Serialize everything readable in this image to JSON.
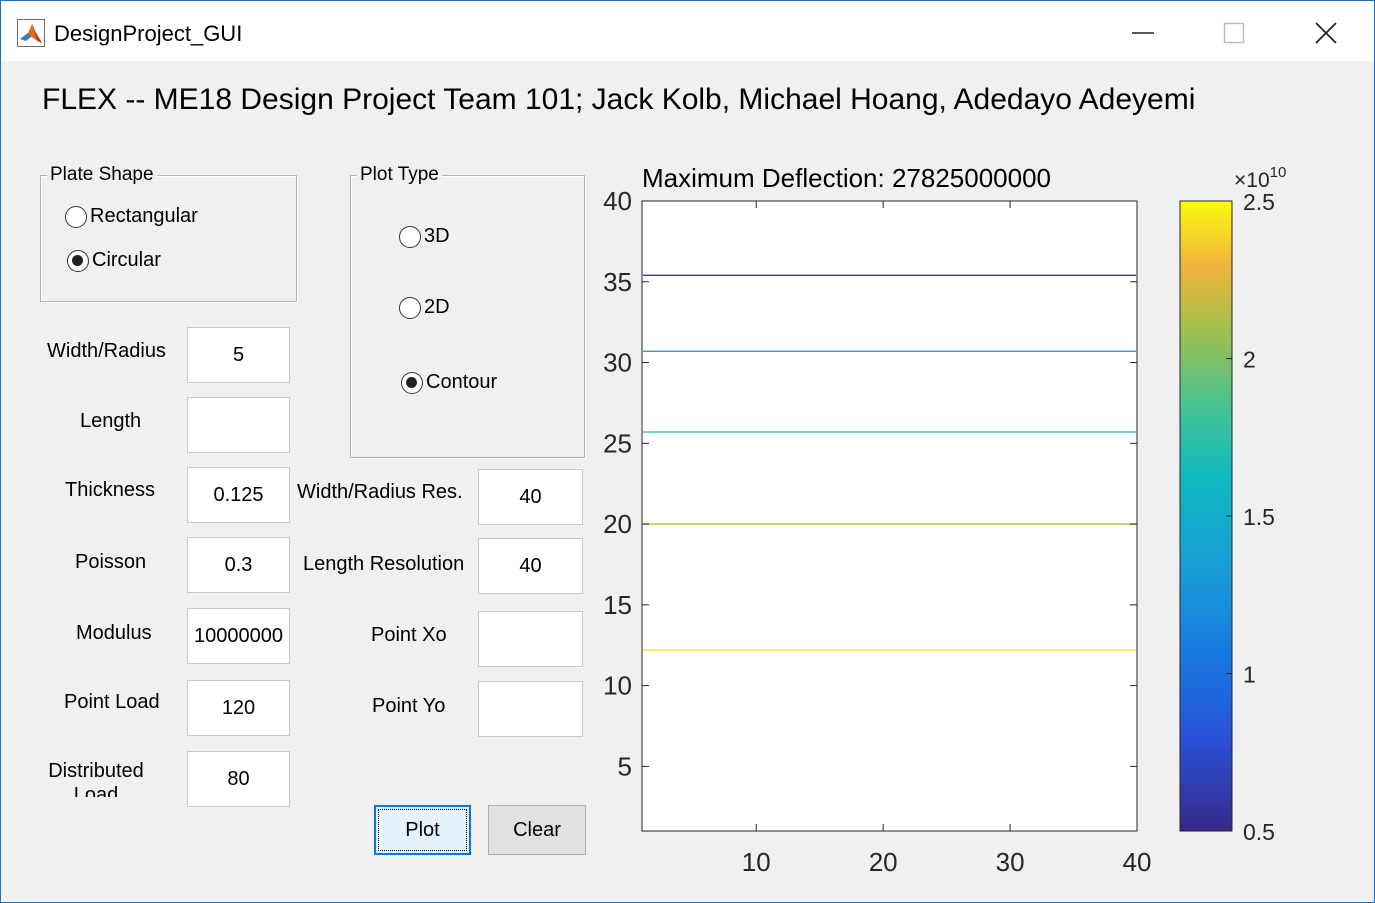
{
  "window": {
    "title": "DesignProject_GUI",
    "icon": "matlab-icon",
    "controls": [
      "minimize-icon",
      "maximize-icon",
      "close-icon"
    ]
  },
  "heading": "FLEX -- ME18 Design Project Team 101; Jack Kolb, Michael Hoang, Adedayo Adeyemi",
  "plate_shape": {
    "title": "Plate Shape",
    "options": [
      {
        "label": "Rectangular",
        "selected": false
      },
      {
        "label": "Circular",
        "selected": true
      }
    ]
  },
  "plot_type": {
    "title": "Plot Type",
    "options": [
      {
        "label": "3D",
        "selected": false
      },
      {
        "label": "2D",
        "selected": false
      },
      {
        "label": "Contour",
        "selected": true
      }
    ]
  },
  "inputs": {
    "width_radius": {
      "label": "Width/Radius",
      "value": "5"
    },
    "length": {
      "label": "Length",
      "value": ""
    },
    "thickness": {
      "label": "Thickness",
      "value": "0.125"
    },
    "poisson": {
      "label": "Poisson",
      "value": "0.3"
    },
    "modulus": {
      "label": "Modulus",
      "value": "10000000"
    },
    "point_load": {
      "label": "Point Load",
      "value": "120"
    },
    "distributed_load": {
      "label": "Distributed Load",
      "value": "80"
    },
    "width_radius_res": {
      "label": "Width/Radius Res.",
      "value": "40"
    },
    "length_resolution": {
      "label": "Length Resolution",
      "value": "40"
    },
    "point_xo": {
      "label": "Point Xo",
      "value": ""
    },
    "point_yo": {
      "label": "Point Yo",
      "value": ""
    }
  },
  "buttons": {
    "plot": "Plot",
    "clear": "Clear"
  },
  "chart_data": {
    "type": "contour",
    "title": "Maximum Deflection: 27825000000",
    "xlim": [
      1,
      40
    ],
    "ylim": [
      1,
      40
    ],
    "xticks": [
      10,
      20,
      30,
      40
    ],
    "yticks": [
      5,
      10,
      15,
      20,
      25,
      30,
      35,
      40
    ],
    "lines": [
      {
        "y": 35.4,
        "level": 0.5,
        "color": "#3d2fb8"
      },
      {
        "y": 30.7,
        "level": 1.0,
        "color": "#2f7fe0"
      },
      {
        "y": 25.7,
        "level": 1.5,
        "color": "#17b8c0"
      },
      {
        "y": 20.0,
        "level": 2.0,
        "color": "#b5c02a"
      },
      {
        "y": 12.2,
        "level": 2.5,
        "color": "#f9eb14"
      }
    ],
    "colorbar": {
      "min": 0.5,
      "max": 2.5,
      "ticks": [
        "2.5",
        "2",
        "1.5",
        "1",
        "0.5"
      ],
      "tick_values": [
        2.5,
        2,
        1.5,
        1,
        0.5
      ],
      "exponent_prefix": "×10",
      "exponent": "10",
      "colormap": "parula"
    }
  }
}
